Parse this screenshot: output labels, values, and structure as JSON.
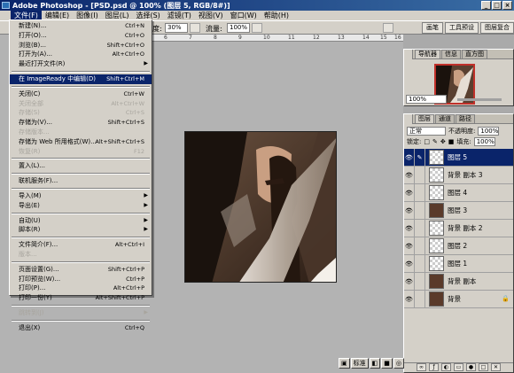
{
  "window": {
    "title": "Adobe Photoshop - [PSD.psd @ 100% (图层 5, RGB/8#)]",
    "controls": [
      "_",
      "□",
      "×"
    ]
  },
  "menubar": {
    "items": [
      "文件(F)",
      "编辑(E)",
      "图像(I)",
      "图层(L)",
      "选择(S)",
      "滤镜(T)",
      "视图(V)",
      "窗口(W)",
      "帮助(H)"
    ]
  },
  "options": {
    "opacity_label": "度:",
    "opacity_value": "30%",
    "flow_label": "流量:",
    "flow_value": "100%",
    "wells": [
      "画笔",
      "工具预设",
      "图层复合"
    ]
  },
  "ruler": {
    "ticks": [
      "6",
      "7",
      "8",
      "9",
      "10",
      "11",
      "12",
      "13",
      "14",
      "15",
      "16"
    ]
  },
  "filemenu": {
    "items": [
      {
        "label": "新建(N)...",
        "shortcut": "Ctrl+N",
        "state": "normal"
      },
      {
        "label": "打开(O)...",
        "shortcut": "Ctrl+O",
        "state": "normal"
      },
      {
        "label": "浏览(B)...",
        "shortcut": "Shift+Ctrl+O",
        "state": "normal"
      },
      {
        "label": "打开为(A)...",
        "shortcut": "Alt+Ctrl+O",
        "state": "normal"
      },
      {
        "label": "最近打开文件(R)",
        "shortcut": "",
        "state": "submenu"
      },
      {
        "label": "---"
      },
      {
        "label": "在 ImageReady 中编辑(D)",
        "shortcut": "Shift+Ctrl+M",
        "state": "highlighted"
      },
      {
        "label": "---"
      },
      {
        "label": "关闭(C)",
        "shortcut": "Ctrl+W",
        "state": "normal"
      },
      {
        "label": "关闭全部",
        "shortcut": "Alt+Ctrl+W",
        "state": "disabled"
      },
      {
        "label": "存储(S)",
        "shortcut": "Ctrl+S",
        "state": "disabled"
      },
      {
        "label": "存储为(V)...",
        "shortcut": "Shift+Ctrl+S",
        "state": "normal"
      },
      {
        "label": "存储版本...",
        "shortcut": "",
        "state": "disabled"
      },
      {
        "label": "存储为 Web 所用格式(W)...",
        "shortcut": "Alt+Shift+Ctrl+S",
        "state": "normal"
      },
      {
        "label": "恢复(R)",
        "shortcut": "F12",
        "state": "disabled"
      },
      {
        "label": "---"
      },
      {
        "label": "置入(L)...",
        "shortcut": "",
        "state": "normal"
      },
      {
        "label": "---"
      },
      {
        "label": "联机服务(F)...",
        "shortcut": "",
        "state": "normal"
      },
      {
        "label": "---"
      },
      {
        "label": "导入(M)",
        "shortcut": "",
        "state": "submenu"
      },
      {
        "label": "导出(E)",
        "shortcut": "",
        "state": "submenu"
      },
      {
        "label": "---"
      },
      {
        "label": "自动(U)",
        "shortcut": "",
        "state": "submenu"
      },
      {
        "label": "脚本(R)",
        "shortcut": "",
        "state": "submenu"
      },
      {
        "label": "---"
      },
      {
        "label": "文件简介(F)...",
        "shortcut": "Alt+Ctrl+I",
        "state": "normal"
      },
      {
        "label": "版本...",
        "shortcut": "",
        "state": "disabled"
      },
      {
        "label": "---"
      },
      {
        "label": "页面设置(G)...",
        "shortcut": "Shift+Ctrl+P",
        "state": "normal"
      },
      {
        "label": "打印预览(W)...",
        "shortcut": "Ctrl+P",
        "state": "normal"
      },
      {
        "label": "打印(P)...",
        "shortcut": "Alt+Ctrl+P",
        "state": "normal"
      },
      {
        "label": "打印一份(Y)",
        "shortcut": "Alt+Shift+Ctrl+P",
        "state": "normal"
      },
      {
        "label": "---"
      },
      {
        "label": "跳转到(J)",
        "shortcut": "",
        "state": "disabled-submenu"
      },
      {
        "label": "---"
      },
      {
        "label": "退出(X)",
        "shortcut": "Ctrl+Q",
        "state": "normal"
      }
    ]
  },
  "navigator": {
    "tabs": [
      "导航器",
      "信息",
      "直方图"
    ],
    "zoom": "100%"
  },
  "layers": {
    "tabs": [
      "图层",
      "通道",
      "路径"
    ],
    "blend_mode": "正常",
    "opacity_label": "不透明度:",
    "opacity_value": "100%",
    "lock_label": "锁定:",
    "fill_label": "填充:",
    "fill_value": "100%",
    "items": [
      {
        "name": "图层 5",
        "selected": true,
        "thumb": "transparent"
      },
      {
        "name": "背景 副本 3",
        "selected": false,
        "thumb": "transparent"
      },
      {
        "name": "图层 4",
        "selected": false,
        "thumb": "transparent"
      },
      {
        "name": "图层 3",
        "selected": false,
        "thumb": "photo"
      },
      {
        "name": "背景 副本 2",
        "selected": false,
        "thumb": "transparent"
      },
      {
        "name": "图层 2",
        "selected": false,
        "thumb": "transparent"
      },
      {
        "name": "图层 1",
        "selected": false,
        "thumb": "transparent"
      },
      {
        "name": "背景 副本",
        "selected": false,
        "thumb": "photo"
      },
      {
        "name": "背景",
        "selected": false,
        "thumb": "photo",
        "locked": true
      }
    ]
  },
  "bottombar": {
    "mode_label": "标准"
  },
  "colors": {
    "title_start": "#0a246a",
    "title_end": "#3a6ea5",
    "chrome": "#d4d0c8",
    "highlight": "#0a246a",
    "workspace": "#b3b3b3"
  }
}
